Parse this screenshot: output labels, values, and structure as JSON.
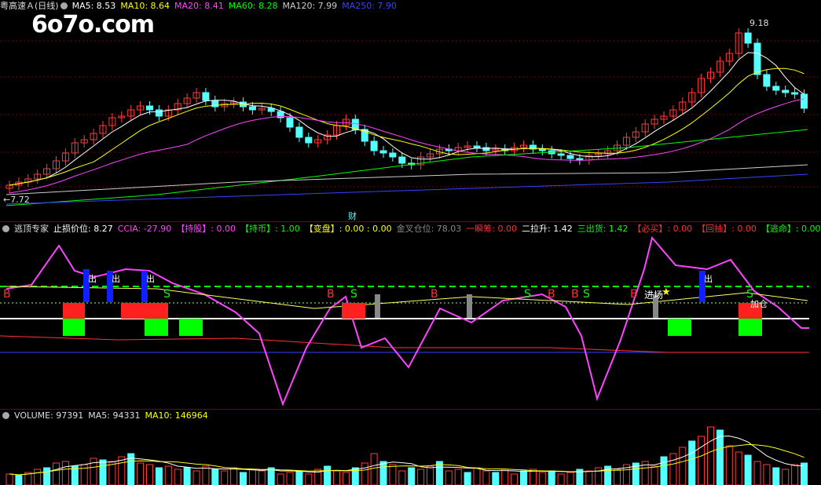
{
  "watermark": "6o7o.com",
  "main": {
    "title": "粤高速Ａ(日线)",
    "ma": [
      {
        "label": "MA5: 8.53",
        "color": "#ffffff"
      },
      {
        "label": "MA10: 8.64",
        "color": "#ffff00"
      },
      {
        "label": "MA20: 8.41",
        "color": "#ff44ff"
      },
      {
        "label": "MA60: 8.28",
        "color": "#00ff00"
      },
      {
        "label": "MA120: 7.99",
        "color": "#cccccc"
      },
      {
        "label": "MA250: 7.90",
        "color": "#3344ff"
      }
    ],
    "high_label": "9.18",
    "low_label": "7.72",
    "event_label": "财"
  },
  "indicator": {
    "title": "逃顶专家",
    "items": [
      {
        "label": "止损价位: 8.27",
        "color": "#ffffff"
      },
      {
        "label": "CCIA: -27.90",
        "color": "#ff44ff"
      },
      {
        "label": "【持股】: 0.00",
        "color": "#ff44ff"
      },
      {
        "label": "【持币】: 1.00",
        "color": "#00ff00"
      },
      {
        "label": "【变盘】: 0.00 : 0.00",
        "color": "#ffff00"
      },
      {
        "label": "金叉仓位: 78.03",
        "color": "#888888"
      },
      {
        "label": "一瞬筹: 0.00",
        "color": "#ff3030"
      },
      {
        "label": "二拉升: 1.42",
        "color": "#ffffff"
      },
      {
        "label": "三出货: 1.42",
        "color": "#00ff00"
      },
      {
        "label": "【必买】: 0.00",
        "color": "#ff3030"
      },
      {
        "label": "【回抽】: 0.00",
        "color": "#ff3030"
      },
      {
        "label": "【逃命】: 0.00",
        "color": "#00ff00"
      }
    ],
    "marks": {
      "buy": "B",
      "sell": "S",
      "out": "出",
      "enter": "进场",
      "add": "加仓",
      "star": "★"
    }
  },
  "volume": {
    "items": [
      {
        "label": "VOLUME: 97391",
        "color": "#dddddd"
      },
      {
        "label": "MA5: 94331",
        "color": "#dddddd"
      },
      {
        "label": "MA10: 146964",
        "color": "#ffff00"
      }
    ]
  },
  "colors": {
    "up": "#ff3b3b",
    "down": "#54ffff",
    "grid": "#7a0000"
  }
}
